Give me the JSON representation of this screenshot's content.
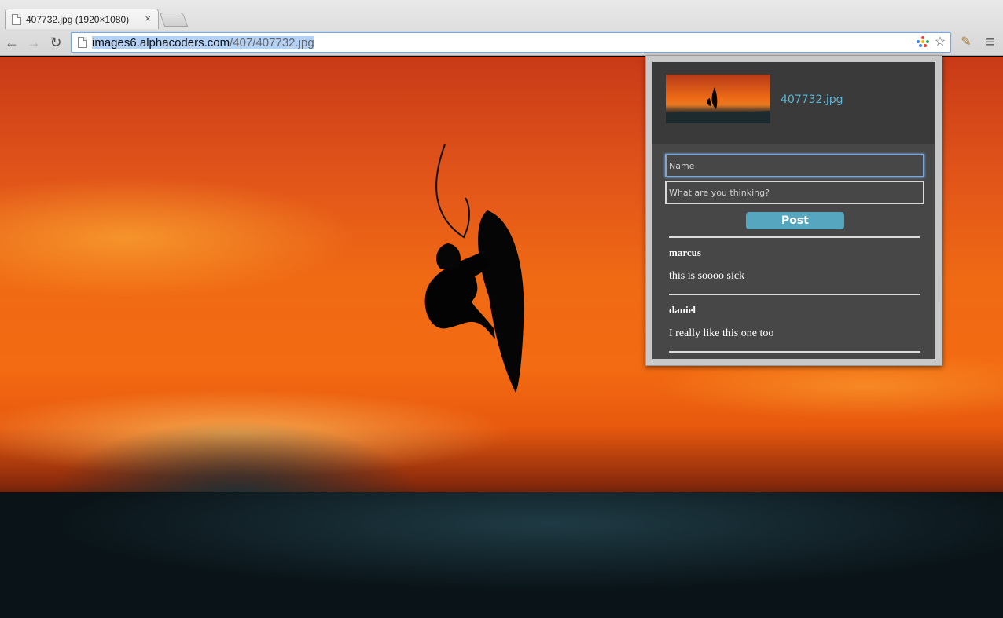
{
  "tab": {
    "title": "407732.jpg (1920×1080)",
    "close": "×"
  },
  "toolbar": {
    "back": "←",
    "forward": "→",
    "reload": "↻",
    "url_host": "images6.alphacoders.com",
    "url_path": "/407/407732.jpg",
    "star": "☆",
    "wand": "✎",
    "menu": "≡"
  },
  "popup": {
    "file_name": "407732.jpg",
    "name_placeholder": "Name",
    "thought_placeholder": "What are you thinking?",
    "post_label": "Post",
    "comments": [
      {
        "author": "marcus",
        "text": "this is soooo sick"
      },
      {
        "author": "daniel",
        "text": "I really like this one too"
      }
    ]
  },
  "colors": {
    "accent": "#56a6bf",
    "link": "#5cb5d6",
    "popup_bg": "#474747"
  }
}
